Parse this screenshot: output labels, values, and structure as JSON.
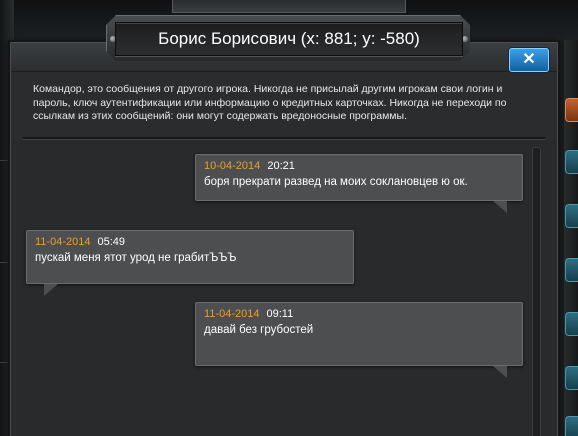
{
  "dialog": {
    "title": "Борис Борисович (x: 881; y: -580)",
    "close_icon": "✕",
    "warning": "Командор, это сообщения от другого игрока. Никогда не присылай другим игрокам свои логин и пароль, ключ аутентификации или информацию о кредитных карточках. Никогда не переходи по ссылкам из этих сообщений: они могут содержать вредоносные программы."
  },
  "messages": [
    {
      "date": "10-04-2014",
      "time": "20:21",
      "text": "боря прекрати развед  на моих сокланoвцев ю ок.",
      "side": "right"
    },
    {
      "date": "11-04-2014",
      "time": "05:49",
      "text": "пускай меня ятот урод не грабитЪЪЪ",
      "side": "left"
    },
    {
      "date": "11-04-2014",
      "time": "09:11",
      "text": "давай без грубостей",
      "side": "right"
    }
  ],
  "colors": {
    "date": "#e8a02b",
    "bubble": "#4c4e50",
    "close_button": "#2a8bd6",
    "panel": "#2a2c2e"
  }
}
